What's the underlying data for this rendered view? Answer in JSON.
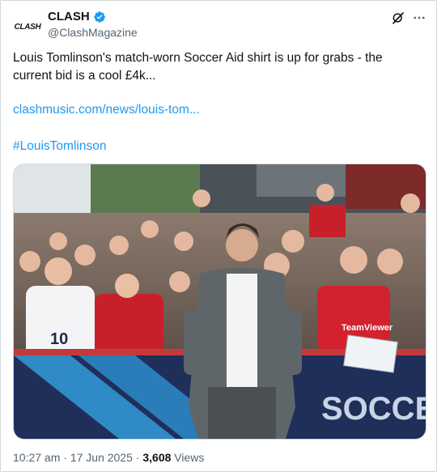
{
  "tweet": {
    "avatar_text": "CLASH",
    "display_name": "CLASH",
    "handle": "@ClashMagazine",
    "body": "Louis Tomlinson's match-worn Soccer Aid shirt is up for grabs - the current bid is a cool £4k...",
    "link": "clashmusic.com/news/louis-tom...",
    "hashtag": "#LouisTomlinson",
    "image_text": {
      "banner": "SOCCEI",
      "shirt_number": "10",
      "sponsor": "TeamViewer"
    },
    "time": "10:27 am",
    "date": "17 Jun 2025",
    "views_count": "3,608",
    "views_label": "Views",
    "separator": "·"
  },
  "colors": {
    "link": "#1d9bf0",
    "verified": "#1d9bf0",
    "secondary_text": "#536471"
  },
  "icons": [
    "verified-badge-icon",
    "grok-icon",
    "more-icon"
  ]
}
